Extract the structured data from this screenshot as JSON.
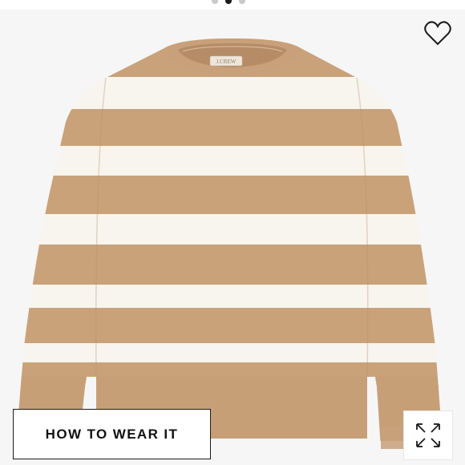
{
  "carousel": {
    "count": 3,
    "active_index": 1
  },
  "product": {
    "image_icon": "striped-sweater-image",
    "label_text": "J.CREW",
    "colors": {
      "stripe_tan": "#c9a27a",
      "stripe_cream": "#f7f5ee",
      "background": "#f6f6f6"
    }
  },
  "actions": {
    "favorite_icon": "heart-icon",
    "how_to_wear_label": "HOW TO WEAR IT",
    "expand_icon": "expand-arrows-icon"
  }
}
